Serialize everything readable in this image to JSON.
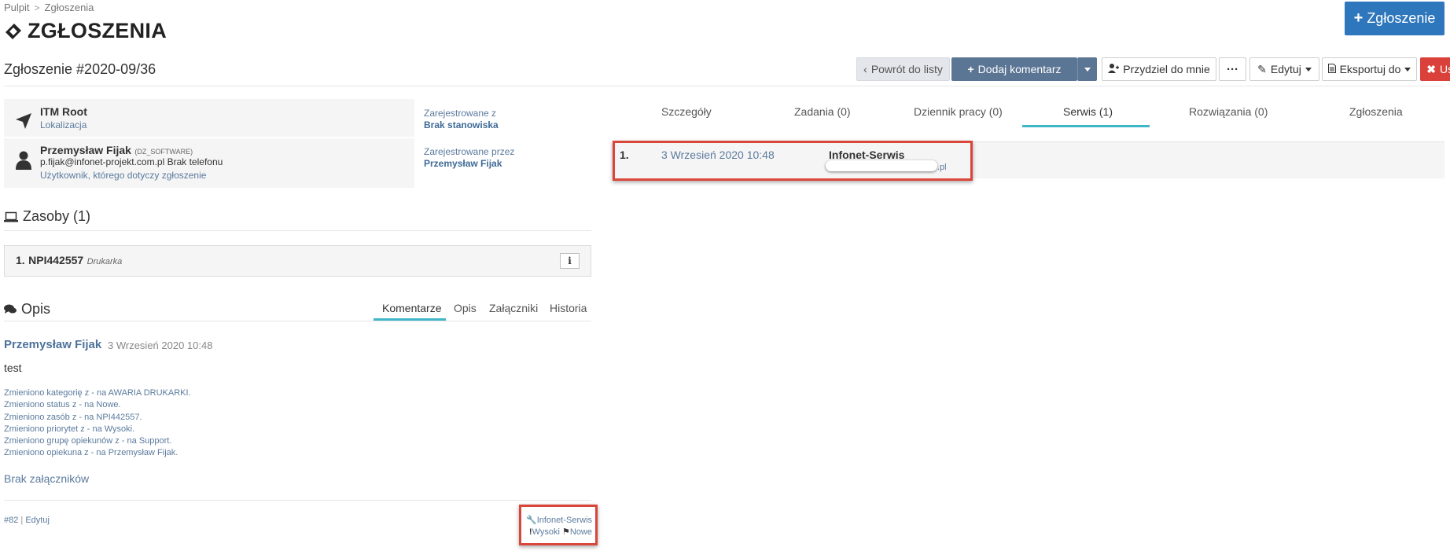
{
  "breadcrumb": {
    "home": "Pulpit",
    "current": "Zgłoszenia",
    "separator": ">"
  },
  "page_title": "ZGŁOSZENIA",
  "new_button": "Zgłoszenie",
  "ticket_number": "Zgłoszenie #2020-09/36",
  "toolbar": {
    "back": "Powrót do listy",
    "add_comment": "Dodaj komentarz",
    "assign_me": "Przydziel do mnie",
    "more": "···",
    "edit": "Edytuj",
    "export": "Eksportuj do",
    "delete": "Usuń"
  },
  "info": {
    "location": {
      "name": "ITM Root",
      "label": "Lokalizacja"
    },
    "user": {
      "name": "Przemysław Fijak",
      "tag": "(DZ_SOFTWARE)",
      "contact": "p.fijak@infonet-projekt.com.pl Brak telefonu",
      "label": "Użytkownik, którego dotyczy zgłoszenie"
    },
    "registered_from": {
      "label": "Zarejestrowane z",
      "value": "Brak stanowiska"
    },
    "registered_by": {
      "label": "Zarejestrowane przez",
      "value": "Przemysław Fijak"
    }
  },
  "resources": {
    "title": "Zasoby (1)",
    "items": [
      {
        "number": "1.",
        "id": "NPI442557",
        "type": "Drukarka"
      }
    ],
    "info_button": "i"
  },
  "description": {
    "title": "Opis",
    "tabs": [
      "Komentarze",
      "Opis",
      "Załączniki",
      "Historia"
    ],
    "active_tab": "Komentarze"
  },
  "comment": {
    "author": "Przemysław Fijak",
    "date": "3 Wrzesień 2020 10:48",
    "text": "test",
    "changes": [
      "Zmieniono kategorię z - na AWARIA DRUKARKI.",
      "Zmieniono status z - na Nowe.",
      "Zmieniono zasób z - na NPI442557.",
      "Zmieniono priorytet z - na Wysoki.",
      "Zmieniono grupę opiekunów z - na Support.",
      "Zmieniono opiekuna z - na Przemysław Fijak."
    ],
    "no_attachments": "Brak załączników",
    "id": "#82",
    "edit": "Edytuj",
    "group": "Infonet-Serwis",
    "priority": "Wysoki",
    "status": "Nowe"
  },
  "right_tabs": {
    "items": [
      "Szczegóły",
      "Zadania (0)",
      "Dziennik pracy (0)",
      "Serwis (1)",
      "Rozwiązania (0)",
      "Zgłoszenia"
    ],
    "active": "Serwis (1)"
  },
  "service": {
    "number": "1.",
    "date": "3 Wrzesień 2020 10:48",
    "name": "Infonet-Serwis",
    "email_suffix": ".pl"
  },
  "colors": {
    "primary": "#2e77bc",
    "toolbar_blue": "#5b7594",
    "danger": "#d9413a",
    "tab_active": "#40b6c9",
    "link": "#5b7a9d",
    "highlight": "#d9463a"
  }
}
